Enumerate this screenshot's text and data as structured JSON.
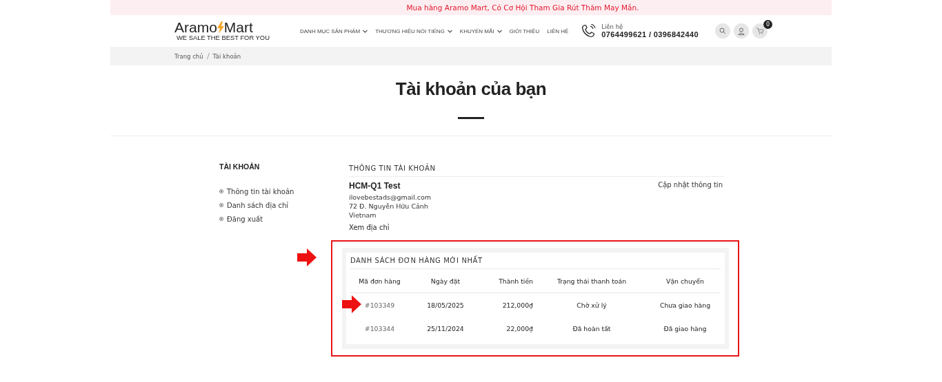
{
  "promo_bar": {
    "text": "Mua hàng Aramo Mart, Có Cơ Hội Tham Gia Rút Thăm May Mắn."
  },
  "header": {
    "logo": {
      "left": "Aramo",
      "right": "Mart",
      "tagline": "WE SALE THE BEST FOR YOU"
    },
    "nav": [
      {
        "label": "DANH MỤC SẢN PHẨM",
        "has_dropdown": true
      },
      {
        "label": "THƯƠNG HIỆU NỔI TIẾNG",
        "has_dropdown": true
      },
      {
        "label": "KHUYẾN MÃI",
        "has_dropdown": true
      },
      {
        "label": "GIỚI THIỆU",
        "has_dropdown": false
      },
      {
        "label": "LIÊN HỆ",
        "has_dropdown": false
      }
    ],
    "contact": {
      "label": "Liên hệ",
      "phones": "0764499621 / 0396842440"
    },
    "cart_count": "0"
  },
  "breadcrumb": [
    "Trang chủ",
    "Tài khoản"
  ],
  "page_title": "Tài khoản của bạn",
  "sidebar": {
    "title": "TÀI KHOẢN",
    "items": [
      "Thông tin tài khoản",
      "Danh sách địa chỉ",
      "Đăng xuất"
    ]
  },
  "account": {
    "heading": "THÔNG TIN TÀI KHOẢN",
    "name": "HCM-Q1 Test",
    "update_link": "Cập nhật thông tin",
    "email": "ilovebestads@gmail.com",
    "address": "72 Đ. Nguyễn Hữu Cảnh",
    "country": "Vietnam",
    "view_address": "Xem địa chỉ"
  },
  "orders": {
    "heading": "DANH SÁCH ĐƠN HÀNG MỚI NHẤT",
    "columns": [
      "Mã đơn hàng",
      "Ngày đặt",
      "Thành tiền",
      "Trạng thái thanh toán",
      "Vận chuyển"
    ],
    "rows": [
      [
        "#103349",
        "18/05/2025",
        "212,000₫",
        "Chờ xử lý",
        "Chưa giao hàng"
      ],
      [
        "#103344",
        "25/11/2024",
        "22,000₫",
        "Đã hoàn tất",
        "Đã giao hàng"
      ]
    ]
  }
}
